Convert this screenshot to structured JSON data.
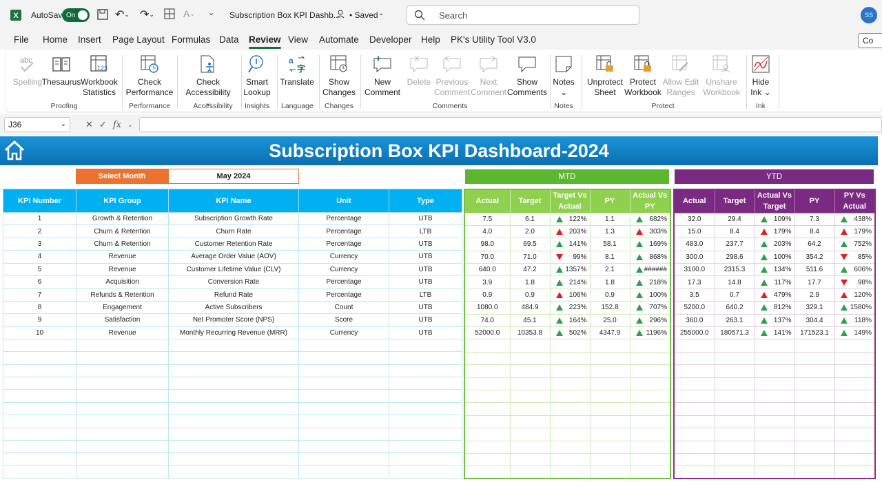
{
  "titlebar": {
    "autosave_label": "AutoSave",
    "toggle_label": "On",
    "doc_title": "Subscription Box KPI Dashb...",
    "saved_label": "• Saved",
    "search_placeholder": "Search",
    "avatar_initials": "SS"
  },
  "menu": {
    "items": [
      "File",
      "Home",
      "Insert",
      "Page Layout",
      "Formulas",
      "Data",
      "Review",
      "View",
      "Automate",
      "Developer",
      "Help",
      "PK's Utility Tool V3.0"
    ],
    "active": "Review",
    "comments_btn": "Co"
  },
  "ribbon": {
    "buttons": [
      {
        "l1": "Spelling",
        "l2": "",
        "enabled": false,
        "icon": "spelling-icon"
      },
      {
        "l1": "Thesaurus",
        "l2": "",
        "enabled": true,
        "icon": "thesaurus-icon"
      },
      {
        "l1": "Workbook",
        "l2": "Statistics",
        "enabled": true,
        "icon": "workbook-statistics-icon"
      },
      {
        "l1": "Check",
        "l2": "Performance",
        "enabled": true,
        "icon": "check-performance-icon"
      },
      {
        "l1": "Check",
        "l2": "Accessibility ⌄",
        "enabled": true,
        "icon": "check-accessibility-icon"
      },
      {
        "l1": "Smart",
        "l2": "Lookup",
        "enabled": true,
        "icon": "smart-lookup-icon"
      },
      {
        "l1": "Translate",
        "l2": "",
        "enabled": true,
        "icon": "translate-icon"
      },
      {
        "l1": "Show",
        "l2": "Changes",
        "enabled": true,
        "icon": "show-changes-icon"
      },
      {
        "l1": "New",
        "l2": "Comment",
        "enabled": true,
        "icon": "new-comment-icon"
      },
      {
        "l1": "Delete",
        "l2": "",
        "enabled": false,
        "icon": "delete-comment-icon"
      },
      {
        "l1": "Previous",
        "l2": "Comment",
        "enabled": false,
        "icon": "previous-comment-icon"
      },
      {
        "l1": "Next",
        "l2": "Comment",
        "enabled": false,
        "icon": "next-comment-icon"
      },
      {
        "l1": "Show",
        "l2": "Comments",
        "enabled": true,
        "icon": "show-comments-icon"
      },
      {
        "l1": "Notes",
        "l2": "⌄",
        "enabled": true,
        "icon": "notes-icon"
      },
      {
        "l1": "Unprotect",
        "l2": "Sheet",
        "enabled": true,
        "icon": "unprotect-sheet-icon"
      },
      {
        "l1": "Protect",
        "l2": "Workbook",
        "enabled": true,
        "icon": "protect-workbook-icon"
      },
      {
        "l1": "Allow Edit",
        "l2": "Ranges",
        "enabled": false,
        "icon": "allow-edit-ranges-icon"
      },
      {
        "l1": "Unshare",
        "l2": "Workbook",
        "enabled": false,
        "icon": "unshare-workbook-icon"
      },
      {
        "l1": "Hide",
        "l2": "Ink ⌄",
        "enabled": true,
        "icon": "hide-ink-icon"
      }
    ],
    "groups": [
      "Proofing",
      "Performance",
      "Accessibility",
      "Insights",
      "Language",
      "Changes",
      "Comments",
      "Notes",
      "Protect",
      "Ink"
    ]
  },
  "formula_bar": {
    "cell_ref": "J36",
    "fx": "fx",
    "value": ""
  },
  "dashboard": {
    "title": "Subscription Box KPI Dashboard-2024",
    "select_month_label": "Select Month",
    "selected_month": "May 2024",
    "mtd_label": "MTD",
    "ytd_label": "YTD",
    "colors": {
      "banner": "#0b7fc4",
      "select": "#ed7230",
      "mtd": "#5bb630",
      "ytd": "#7b2a83",
      "kpi_header": "#00b0f0",
      "up": "#2fa04a",
      "down": "#e02020"
    },
    "kpi_headers": [
      "KPI Number",
      "KPI Group",
      "KPI Name",
      "Unit",
      "Type"
    ],
    "mtd_headers": [
      "Actual",
      "Target",
      "Target Vs Actual",
      "PY",
      "Actual Vs PY"
    ],
    "ytd_headers": [
      "Actual",
      "Target",
      "Actual Vs Target",
      "PY",
      "PY Vs Actual"
    ],
    "kpis": [
      {
        "num": "1",
        "group": "Growth & Retention",
        "name": "Subscription Growth Rate",
        "unit": "Percentage",
        "type": "UTB"
      },
      {
        "num": "2",
        "group": "Churn & Retention",
        "name": "Churn Rate",
        "unit": "Percentage",
        "type": "LTB"
      },
      {
        "num": "3",
        "group": "Churn & Retention",
        "name": "Customer Retention Rate",
        "unit": "Percentage",
        "type": "UTB"
      },
      {
        "num": "4",
        "group": "Revenue",
        "name": "Average Order Value (AOV)",
        "unit": "Currency",
        "type": "UTB"
      },
      {
        "num": "5",
        "group": "Revenue",
        "name": "Customer Lifetime Value (CLV)",
        "unit": "Currency",
        "type": "UTB"
      },
      {
        "num": "6",
        "group": "Acquisition",
        "name": "Conversion Rate",
        "unit": "Percentage",
        "type": "UTB"
      },
      {
        "num": "7",
        "group": "Refunds & Retention",
        "name": "Refund Rate",
        "unit": "Percentage",
        "type": "LTB"
      },
      {
        "num": "8",
        "group": "Engagement",
        "name": "Active Subscribers",
        "unit": "Count",
        "type": "UTB"
      },
      {
        "num": "9",
        "group": "Satisfaction",
        "name": "Net Promoter Score (NPS)",
        "unit": "Score",
        "type": "UTB"
      },
      {
        "num": "10",
        "group": "Revenue",
        "name": "Monthly Recurring Revenue (MRR)",
        "unit": "Currency",
        "type": "UTB"
      }
    ],
    "mtd": [
      {
        "actual": "7.5",
        "target": "6.1",
        "tva": "122%",
        "tva_ind": "up",
        "py": "1.1",
        "avp": "682%",
        "avp_ind": "up"
      },
      {
        "actual": "4.0",
        "target": "2.0",
        "tva": "203%",
        "tva_ind": "up-red",
        "py": "1.3",
        "avp": "303%",
        "avp_ind": "up-red"
      },
      {
        "actual": "98.0",
        "target": "69.5",
        "tva": "141%",
        "tva_ind": "up",
        "py": "58.1",
        "avp": "169%",
        "avp_ind": "up"
      },
      {
        "actual": "70.0",
        "target": "71.0",
        "tva": "99%",
        "tva_ind": "down",
        "py": "8.1",
        "avp": "868%",
        "avp_ind": "up"
      },
      {
        "actual": "640.0",
        "target": "47.2",
        "tva": "1357%",
        "tva_ind": "up",
        "py": "2.1",
        "avp": "######",
        "avp_ind": "up"
      },
      {
        "actual": "3.9",
        "target": "1.8",
        "tva": "214%",
        "tva_ind": "up",
        "py": "1.8",
        "avp": "218%",
        "avp_ind": "up"
      },
      {
        "actual": "0.9",
        "target": "0.9",
        "tva": "106%",
        "tva_ind": "up-red",
        "py": "0.9",
        "avp": "100%",
        "avp_ind": "up"
      },
      {
        "actual": "1080.0",
        "target": "484.9",
        "tva": "223%",
        "tva_ind": "up",
        "py": "152.8",
        "avp": "707%",
        "avp_ind": "up"
      },
      {
        "actual": "74.0",
        "target": "45.1",
        "tva": "164%",
        "tva_ind": "up",
        "py": "25.0",
        "avp": "296%",
        "avp_ind": "up"
      },
      {
        "actual": "52000.0",
        "target": "10353.8",
        "tva": "502%",
        "tva_ind": "up",
        "py": "4347.9",
        "avp": "1196%",
        "avp_ind": "up"
      }
    ],
    "ytd": [
      {
        "actual": "32.0",
        "target": "29.4",
        "avt": "109%",
        "avt_ind": "up",
        "py": "7.3",
        "pva": "438%",
        "pva_ind": "up"
      },
      {
        "actual": "15.0",
        "target": "8.4",
        "avt": "179%",
        "avt_ind": "up-red",
        "py": "8.4",
        "pva": "179%",
        "pva_ind": "up-red"
      },
      {
        "actual": "483.0",
        "target": "237.7",
        "avt": "203%",
        "avt_ind": "up",
        "py": "64.2",
        "pva": "752%",
        "pva_ind": "up"
      },
      {
        "actual": "300.0",
        "target": "298.6",
        "avt": "100%",
        "avt_ind": "up",
        "py": "354.2",
        "pva": "85%",
        "pva_ind": "down"
      },
      {
        "actual": "3100.0",
        "target": "2315.3",
        "avt": "134%",
        "avt_ind": "up",
        "py": "511.6",
        "pva": "606%",
        "pva_ind": "up"
      },
      {
        "actual": "17.3",
        "target": "14.8",
        "avt": "117%",
        "avt_ind": "up",
        "py": "17.7",
        "pva": "98%",
        "pva_ind": "down"
      },
      {
        "actual": "3.5",
        "target": "0.7",
        "avt": "479%",
        "avt_ind": "up-red",
        "py": "2.9",
        "pva": "120%",
        "pva_ind": "up-red"
      },
      {
        "actual": "5200.0",
        "target": "640.2",
        "avt": "812%",
        "avt_ind": "up",
        "py": "329.1",
        "pva": "1580%",
        "pva_ind": "up"
      },
      {
        "actual": "360.0",
        "target": "263.1",
        "avt": "137%",
        "avt_ind": "up",
        "py": "304.4",
        "pva": "118%",
        "pva_ind": "up"
      },
      {
        "actual": "255000.0",
        "target": "180571.3",
        "avt": "141%",
        "avt_ind": "up",
        "py": "171523.1",
        "pva": "149%",
        "pva_ind": "up"
      }
    ]
  }
}
